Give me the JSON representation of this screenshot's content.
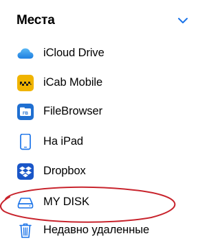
{
  "section": {
    "title": "Места"
  },
  "locations": [
    {
      "label": "iCloud Drive",
      "icon": "icloud-icon"
    },
    {
      "label": "iCab Mobile",
      "icon": "icab-mobile-icon"
    },
    {
      "label": "FileBrowser",
      "icon": "filebrowser-icon"
    },
    {
      "label": "На iPad",
      "icon": "ipad-icon"
    },
    {
      "label": "Dropbox",
      "icon": "dropbox-icon"
    },
    {
      "label": "MY DISK",
      "icon": "external-drive-icon"
    },
    {
      "label": "Недавно удаленные",
      "icon": "trash-icon"
    }
  ],
  "colors": {
    "accent": "#1a73e8",
    "annotation": "#c8232c",
    "icab_bg": "#f0b400",
    "filebrowser_bg": "#1f6fd1",
    "dropbox_bg": "#1a56c8"
  },
  "annotation": {
    "target": "MY DISK",
    "shape": "hand-drawn red ellipse"
  }
}
